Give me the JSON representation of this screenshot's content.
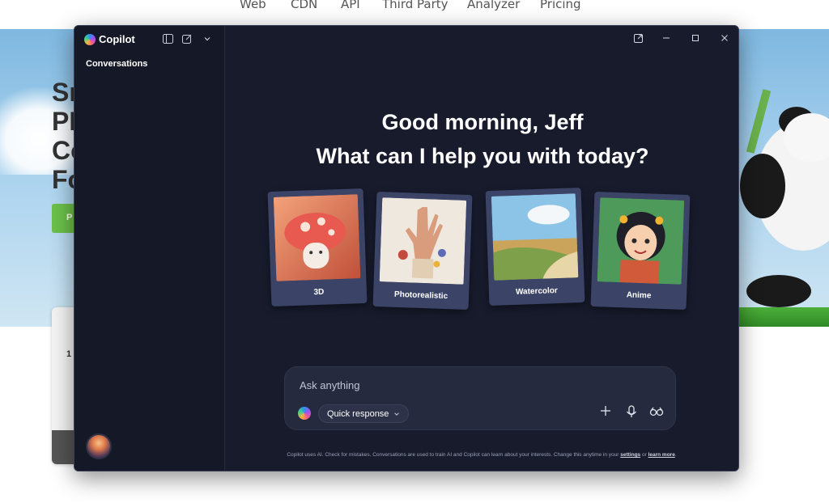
{
  "background_site": {
    "nav": [
      "Web",
      "CDN",
      "API",
      "Third Party",
      "Analyzer",
      "Pricing"
    ],
    "hero_lines": [
      "Sn",
      "PN",
      "Co",
      "Fo"
    ],
    "button_text": "P",
    "card_text": "1"
  },
  "window": {
    "app_name": "Copilot",
    "sidebar": {
      "section_label": "Conversations"
    },
    "icons": {
      "sidebar_toggle": "sidebar-icon",
      "new_chat": "new-chat-icon",
      "menu": "chevron-down-icon",
      "popout": "popout-icon",
      "minimize": "minimize-icon",
      "maximize": "maximize-icon",
      "close": "close-icon"
    }
  },
  "main": {
    "greeting_line1": "Good morning, Jeff",
    "greeting_line2": "What can I help you with today?",
    "style_cards": [
      {
        "label": "3D"
      },
      {
        "label": "Photorealistic"
      },
      {
        "label": "Watercolor"
      },
      {
        "label": "Anime"
      }
    ]
  },
  "composer": {
    "placeholder": "Ask anything",
    "mode_label": "Quick response"
  },
  "footer": {
    "text": "Copilot uses AI. Check for mistakes. Conversations are used to train AI and Copilot can learn about your interests. Change this anytime in your",
    "settings_link": "settings",
    "or_text": "or",
    "learn_more_link": "learn more",
    "period": "."
  },
  "colors": {
    "window_bg": "#171b2c",
    "sidebar_bg": "#151826",
    "card_bg": "#3b4466",
    "composer_bg": "#252a3e"
  }
}
